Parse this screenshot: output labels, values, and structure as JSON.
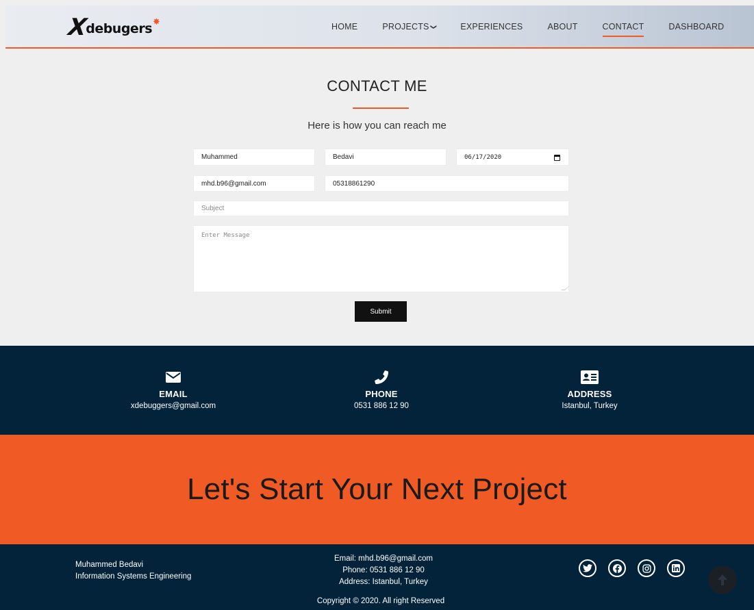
{
  "header": {
    "logo": {
      "x": "X",
      "text": "debugers",
      "star": "✸"
    },
    "nav": [
      {
        "label": "HOME",
        "active": false
      },
      {
        "label": "PROJECTS",
        "active": false,
        "has_caret": true
      },
      {
        "label": "EXPERIENCES",
        "active": false
      },
      {
        "label": "ABOUT",
        "active": false
      },
      {
        "label": "CONTACT",
        "active": true
      },
      {
        "label": "DASHBOARD",
        "active": false
      }
    ],
    "caret": "❯"
  },
  "contact": {
    "title": "CONTACT ME",
    "subtitle": "Here is how you can reach me",
    "first_name": "Muhammed",
    "last_name": "Bedavi",
    "date": "06/17/2020",
    "email": "mhd.b96@gmail.com",
    "phone": "05318861290",
    "subject_placeholder": "Subject",
    "message_placeholder": "Enter Message",
    "submit_label": "Submit"
  },
  "info": {
    "email": {
      "label": "EMAIL",
      "value": "xdebuggers@gmail.com",
      "icon": "envelope-icon"
    },
    "phone": {
      "label": "PHONE",
      "value": "0531 886 12 90",
      "icon": "phone-icon"
    },
    "address": {
      "label": "ADDRESS",
      "value": "Istanbul, Turkey",
      "icon": "address-card-icon"
    }
  },
  "cta": {
    "text": "Let's Start Your Next Project"
  },
  "footer": {
    "name": "Muhammed Bedavi",
    "role": "Information Systems Engineering",
    "email_line": "Email: mhd.b96@gmail.com",
    "phone_line": "Phone: 0531 886 12 90",
    "address_line": "Address: Istanbul, Turkey",
    "copyright": "Copyright © 2020. All right Reserved",
    "socials": [
      "twitter-icon",
      "facebook-icon",
      "instagram-icon",
      "linkedin-icon"
    ]
  },
  "colors": {
    "accent": "#f05a24",
    "dark": "#03233a",
    "page_bg": "#efefef"
  }
}
